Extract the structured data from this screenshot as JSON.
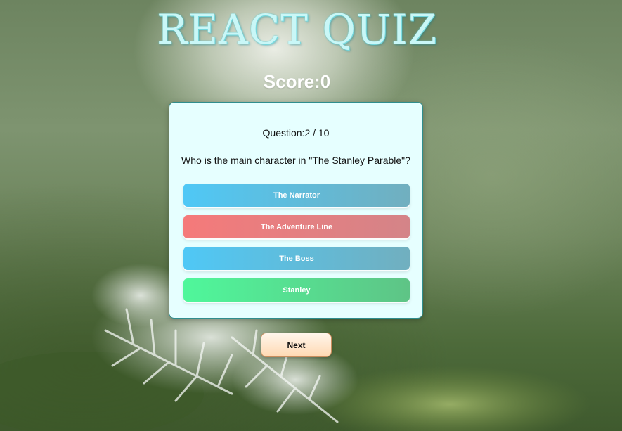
{
  "app": {
    "title": "REACT QUIZ"
  },
  "score": {
    "label": "Score:0"
  },
  "question": {
    "counter": "Question:2 / 10",
    "text": "Who is the main character in \"The Stanley Parable\"?"
  },
  "answers": [
    {
      "label": "The Narrator",
      "color": "#4fc8f6"
    },
    {
      "label": "The Adventure Line",
      "color": "#f57a7a"
    },
    {
      "label": "The Boss",
      "color": "#4fc8f6"
    },
    {
      "label": "Stanley",
      "color": "#4ff79b"
    }
  ],
  "controls": {
    "next_label": "Next"
  },
  "colors": {
    "title": "#c9f7f7",
    "card_background": "#e6ffff",
    "card_border": "#2f8e8e",
    "next_button": "#ffd9b3"
  }
}
